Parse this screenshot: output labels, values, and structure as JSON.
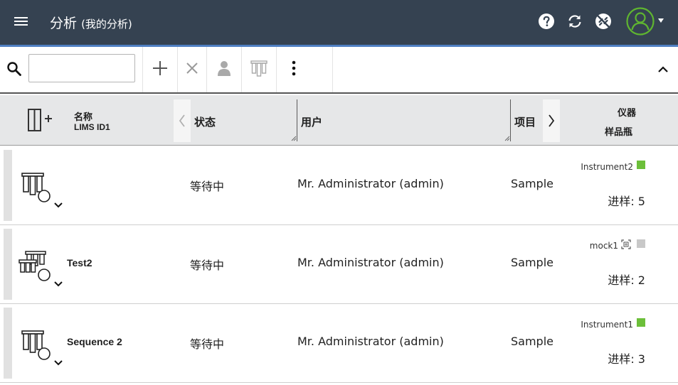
{
  "header": {
    "title": "分析",
    "subtitle": "(我的分析)",
    "colors": {
      "background": "#354251",
      "accent": "#4f7fc2",
      "avatar": "#5fb530"
    },
    "icons": [
      "menu-icon",
      "help-icon",
      "refresh-icon",
      "disconnected-icon",
      "user-avatar-icon"
    ]
  },
  "toolbar": {
    "search_value": "",
    "search_placeholder": "",
    "icons": [
      "search-icon",
      "add-icon",
      "delete-icon",
      "user-icon",
      "vials-icon",
      "more-vertical-icon",
      "collapse-up-icon"
    ]
  },
  "columns": {
    "name": "名称",
    "lims_id": "LIMS ID1",
    "status": "状态",
    "user": "用户",
    "project": "项目",
    "instrument": "仪器",
    "vial": "样品瓶"
  },
  "rows": [
    {
      "name": "",
      "status": "等待中",
      "user": "Mr. Administrator (admin)",
      "project": "Sample",
      "instrument": "Instrument2",
      "instrument_status_color": "#6cbf3a",
      "inject": "进样: 5",
      "icon": "vials-single-icon"
    },
    {
      "name": "Test2",
      "status": "等待中",
      "user": "Mr. Administrator (admin)",
      "project": "Sample",
      "instrument": "mock1",
      "instrument_status_color": "#c8c8c8",
      "inject": "进样: 2",
      "icon": "vials-multi-icon"
    },
    {
      "name": "Sequence 2",
      "status": "等待中",
      "user": "Mr. Administrator (admin)",
      "project": "Sample",
      "instrument": "Instrument1",
      "instrument_status_color": "#6cbf3a",
      "inject": "进样: 3",
      "icon": "vials-single-icon"
    }
  ]
}
